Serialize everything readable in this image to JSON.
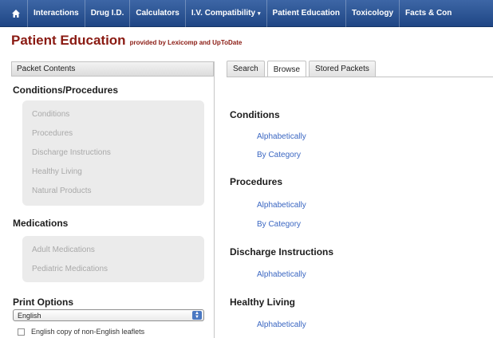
{
  "nav": {
    "home_icon": "home-icon",
    "items": [
      {
        "label": "Interactions"
      },
      {
        "label": "Drug I.D."
      },
      {
        "label": "Calculators"
      },
      {
        "label": "I.V. Compatibility"
      },
      {
        "label": "Patient Education"
      },
      {
        "label": "Toxicology"
      },
      {
        "label": "Facts & Con"
      }
    ],
    "dropdown_caret": "▾"
  },
  "header": {
    "title": "Patient Education",
    "subtitle": "provided by Lexicomp and UpToDate",
    "title_color": "#8a1a12"
  },
  "sidebar": {
    "header": "Packet Contents",
    "sections": [
      {
        "heading": "Conditions/Procedures",
        "items": [
          "Conditions",
          "Procedures",
          "Discharge Instructions",
          "Healthy Living",
          "Natural Products"
        ]
      },
      {
        "heading": "Medications",
        "items": [
          "Adult Medications",
          "Pediatric Medications"
        ]
      }
    ],
    "print_options": {
      "heading": "Print Options",
      "selected": "English",
      "checkbox_label": "English copy of non-English leaflets"
    }
  },
  "tabs": [
    {
      "label": "Search",
      "active": false
    },
    {
      "label": "Browse",
      "active": true
    },
    {
      "label": "Stored Packets",
      "active": false
    }
  ],
  "browse": {
    "sections": [
      {
        "heading": "Conditions",
        "links": [
          "Alphabetically",
          "By Category"
        ]
      },
      {
        "heading": "Procedures",
        "links": [
          "Alphabetically",
          "By Category"
        ]
      },
      {
        "heading": "Discharge Instructions",
        "links": [
          "Alphabetically"
        ]
      },
      {
        "heading": "Healthy Living",
        "links": [
          "Alphabetically"
        ]
      }
    ],
    "link_color": "#3b67c2"
  }
}
